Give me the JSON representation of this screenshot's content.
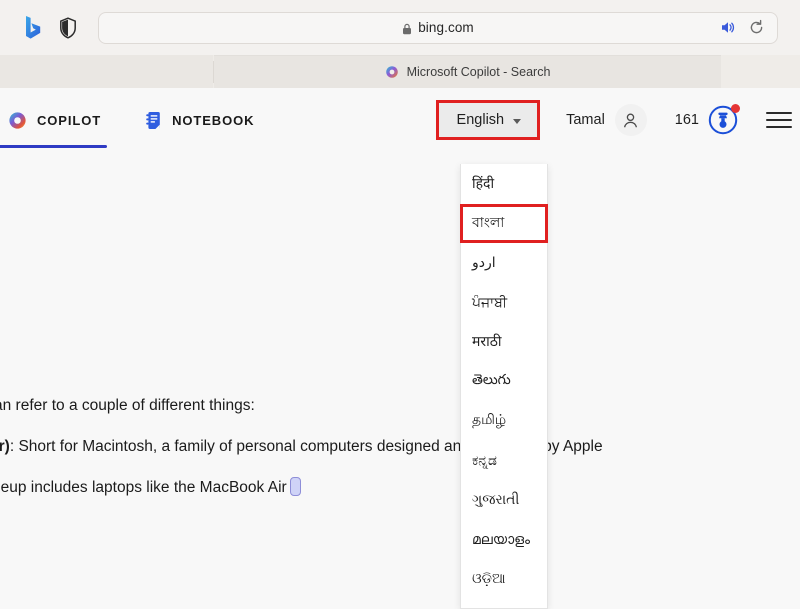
{
  "browser": {
    "icons": {
      "bing_logo": "bing-logo-icon",
      "shield": "shield-icon",
      "lock": "lock-icon",
      "speaker": "speaker-icon",
      "reload": "reload-icon"
    },
    "url": "bing.com",
    "tab": {
      "title": "Microsoft Copilot - Search",
      "favicon": "copilot-icon"
    }
  },
  "topnav": {
    "tabs": [
      {
        "label": "COPILOT",
        "icon": "copilot-icon",
        "active": true
      },
      {
        "label": "NOTEBOOK",
        "icon": "notebook-icon",
        "active": false
      }
    ],
    "language_button": {
      "label": "English",
      "caret": "chevron-down-icon",
      "highlight_color": "#e02020"
    },
    "account": {
      "name": "Tamal",
      "avatar_icon": "person-icon"
    },
    "rewards": {
      "count": "161",
      "icon": "rewards-badge-icon",
      "notification_dot_color": "#e53535"
    },
    "menu": {
      "icon": "hamburger-menu-icon"
    }
  },
  "language_menu": {
    "highlight_color": "#e02020",
    "highlighted_index": 1,
    "items": [
      {
        "label": "हिंदी"
      },
      {
        "label": "বাংলা"
      },
      {
        "label": "اردو"
      },
      {
        "label": "ਪੰਜਾਬੀ"
      },
      {
        "label": "मराठी"
      },
      {
        "label": "తెలుగు"
      },
      {
        "label": "தமிழ்"
      },
      {
        "label": "ಕನ್ನಡ"
      },
      {
        "label": "ગુજરાતી"
      },
      {
        "label": "മലയാളം"
      },
      {
        "label": "ଓଡ଼ିଆ"
      }
    ]
  },
  "answer": {
    "line1": "an refer to a couple of different things:",
    "line2_bold": "er)",
    "line2_rest": ": Short for Macintosh, a family of personal computers designed and marketed by Apple",
    "line3": "neup includes laptops like the MacBook Air"
  }
}
